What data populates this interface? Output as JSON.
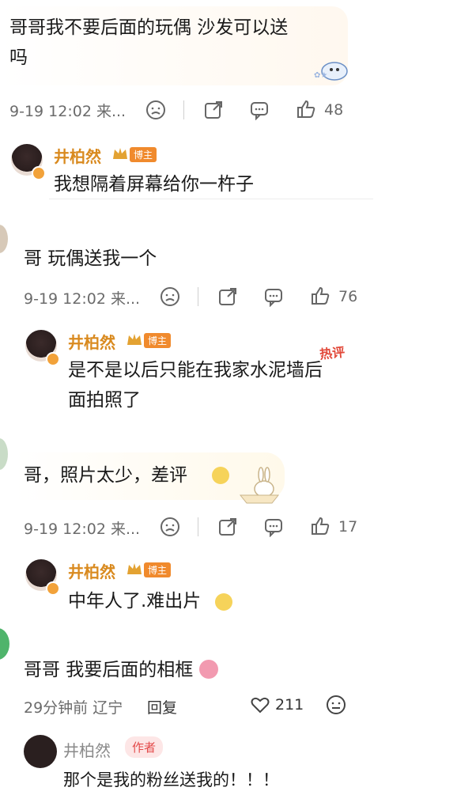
{
  "c1": {
    "text_line1": "哥哥我不要后面的玩偶 沙发可以送",
    "text_line2": "吗",
    "time": "9-19 12:02 来...",
    "likes": "48"
  },
  "r1": {
    "name": "井柏然",
    "badge": "博主",
    "text": "我想隔着屏幕给你一杵子"
  },
  "c2": {
    "text": "哥 玩偶送我一个",
    "time": "9-19 12:02 来...",
    "likes": "76"
  },
  "r2": {
    "name": "井柏然",
    "badge": "博主",
    "hot": "热评",
    "text_line1": "是不是以后只能在我家水泥墙后",
    "text_line2": "面拍照了"
  },
  "c3": {
    "text": "哥，照片太少，差评",
    "time": "9-19 12:02 来...",
    "likes": "17"
  },
  "r3": {
    "name": "井柏然",
    "badge": "博主",
    "text": "中年人了.难出片"
  },
  "c4": {
    "text": "哥哥 我要后面的相框",
    "time": "29分钟前 辽宁",
    "reply": "回复",
    "likes": "211"
  },
  "r4": {
    "name": "井柏然",
    "badge": "作者",
    "text": "那个是我的粉丝送我的！！！"
  },
  "colors": {
    "name": "#d98a1f",
    "badge": "#f08a2d",
    "author_text": "#e34b4b"
  }
}
